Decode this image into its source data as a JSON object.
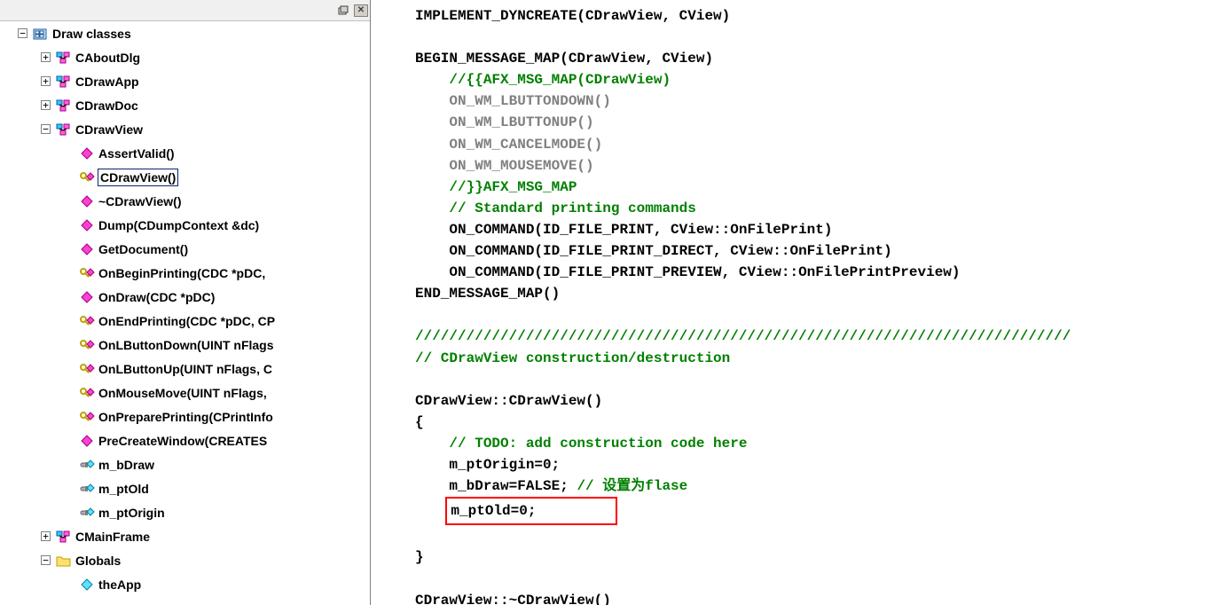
{
  "tree": {
    "root": {
      "label": "Draw classes",
      "children": [
        {
          "label": "CAboutDlg",
          "icon": "class",
          "exp": "plus"
        },
        {
          "label": "CDrawApp",
          "icon": "class",
          "exp": "plus"
        },
        {
          "label": "CDrawDoc",
          "icon": "class",
          "exp": "plus"
        },
        {
          "label": "CDrawView",
          "icon": "class",
          "exp": "minus",
          "children": [
            {
              "label": "AssertValid()",
              "icon": "fn"
            },
            {
              "label": "CDrawView()",
              "icon": "kfn",
              "sel": true
            },
            {
              "label": "~CDrawView()",
              "icon": "fn"
            },
            {
              "label": "Dump(CDumpContext &dc)",
              "icon": "fn"
            },
            {
              "label": "GetDocument()",
              "icon": "fn"
            },
            {
              "label": "OnBeginPrinting(CDC *pDC, ",
              "icon": "kfn"
            },
            {
              "label": "OnDraw(CDC *pDC)",
              "icon": "fn"
            },
            {
              "label": "OnEndPrinting(CDC *pDC, CP",
              "icon": "kfn"
            },
            {
              "label": "OnLButtonDown(UINT nFlags",
              "icon": "kfn"
            },
            {
              "label": "OnLButtonUp(UINT nFlags, C",
              "icon": "kfn"
            },
            {
              "label": "OnMouseMove(UINT nFlags,",
              "icon": "kfn"
            },
            {
              "label": "OnPreparePrinting(CPrintInfo",
              "icon": "kfn"
            },
            {
              "label": "PreCreateWindow(CREATES",
              "icon": "fn"
            },
            {
              "label": "m_bDraw",
              "icon": "var"
            },
            {
              "label": "m_ptOld",
              "icon": "var"
            },
            {
              "label": "m_ptOrigin",
              "icon": "var"
            }
          ]
        },
        {
          "label": "CMainFrame",
          "icon": "class",
          "exp": "plus"
        },
        {
          "label": "Globals",
          "icon": "folder",
          "exp": "minus",
          "children": [
            {
              "label": "theApp",
              "icon": "gvar"
            }
          ]
        }
      ]
    }
  },
  "code": {
    "l01": "IMPLEMENT_DYNCREATE(CDrawView, CView)",
    "l02": "",
    "l03": "BEGIN_MESSAGE_MAP(CDrawView, CView)",
    "l04": "    //{{AFX_MSG_MAP(CDrawView)",
    "l05": "    ON_WM_LBUTTONDOWN()",
    "l06": "    ON_WM_LBUTTONUP()",
    "l07": "    ON_WM_CANCELMODE()",
    "l08": "    ON_WM_MOUSEMOVE()",
    "l09": "    //}}AFX_MSG_MAP",
    "l10": "    // Standard printing commands",
    "l11": "    ON_COMMAND(ID_FILE_PRINT, CView::OnFilePrint)",
    "l12": "    ON_COMMAND(ID_FILE_PRINT_DIRECT, CView::OnFilePrint)",
    "l13": "    ON_COMMAND(ID_FILE_PRINT_PREVIEW, CView::OnFilePrintPreview)",
    "l14": "END_MESSAGE_MAP()",
    "l15": "",
    "l16": "/////////////////////////////////////////////////////////////////////////////",
    "l17": "// CDrawView construction/destruction",
    "l18": "",
    "l19": "CDrawView::CDrawView()",
    "l20": "{",
    "l21": "    // TODO: add construction code here",
    "l22": "    m_ptOrigin=0;",
    "l23a": "    m_bDraw=FALSE; ",
    "l23b": "// 设置为flase",
    "l24": "m_ptOld=0;",
    "l25": "",
    "l26": "}",
    "l27": "",
    "l28": "CDrawView::~CDrawView()"
  }
}
